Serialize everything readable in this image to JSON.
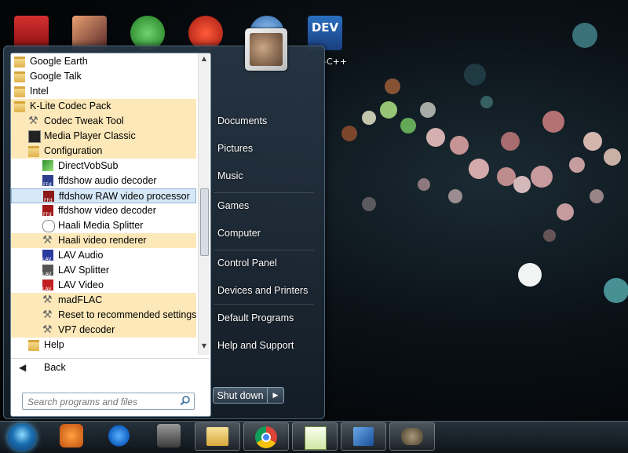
{
  "desktop": {
    "icons": [
      {
        "name": "adobe-reader",
        "label": ""
      },
      {
        "name": "anime-app",
        "label": ""
      },
      {
        "name": "green-app",
        "label": ""
      },
      {
        "name": "ccleaner",
        "label": ""
      },
      {
        "name": "blue-app",
        "label": ""
      },
      {
        "name": "dev-cpp",
        "label": "-C++",
        "icon_text": "DEV"
      }
    ]
  },
  "start_menu": {
    "programs": [
      {
        "label": "Google Earth",
        "icon": "folder-icon",
        "indent": 0,
        "highlight": false
      },
      {
        "label": "Google Talk",
        "icon": "folder-icon",
        "indent": 0,
        "highlight": false
      },
      {
        "label": "Intel",
        "icon": "folder-icon",
        "indent": 0,
        "highlight": false
      },
      {
        "label": "K-Lite Codec Pack",
        "icon": "folder-icon",
        "indent": 0,
        "highlight": true
      },
      {
        "label": "Codec Tweak Tool",
        "icon": "tool-icon",
        "indent": 1,
        "highlight": true
      },
      {
        "label": "Media Player Classic",
        "icon": "mpc-icon",
        "indent": 1,
        "highlight": true
      },
      {
        "label": "Configuration",
        "icon": "folder-icon",
        "indent": 1,
        "highlight": true
      },
      {
        "label": "DirectVobSub",
        "icon": "directvobsub-icon",
        "indent": 2,
        "highlight": false
      },
      {
        "label": "ffdshow audio decoder",
        "icon": "ffdshow-audio-icon",
        "indent": 2,
        "highlight": false
      },
      {
        "label": "ffdshow RAW video processor",
        "icon": "ffdshow-raw-icon",
        "indent": 2,
        "highlight": false,
        "selected": true
      },
      {
        "label": "ffdshow video decoder",
        "icon": "ffdshow-video-icon",
        "indent": 2,
        "highlight": false
      },
      {
        "label": "Haali Media Splitter",
        "icon": "haali-icon",
        "indent": 2,
        "highlight": false
      },
      {
        "label": "Haali video renderer",
        "icon": "tool-icon",
        "indent": 2,
        "highlight": true
      },
      {
        "label": "LAV Audio",
        "icon": "lav-audio-icon",
        "indent": 2,
        "highlight": false
      },
      {
        "label": "LAV Splitter",
        "icon": "lav-splitter-icon",
        "indent": 2,
        "highlight": false
      },
      {
        "label": "LAV Video",
        "icon": "lav-video-icon",
        "indent": 2,
        "highlight": false
      },
      {
        "label": "madFLAC",
        "icon": "tool-icon",
        "indent": 2,
        "highlight": true
      },
      {
        "label": "Reset to recommended settings",
        "icon": "tool-icon",
        "indent": 2,
        "highlight": true
      },
      {
        "label": "VP7 decoder",
        "icon": "tool-icon",
        "indent": 2,
        "highlight": true
      },
      {
        "label": "Help",
        "icon": "folder-icon",
        "indent": 1,
        "highlight": false
      }
    ],
    "back_label": "Back",
    "search_placeholder": "Search programs and files",
    "right_items": [
      {
        "label": "Documents",
        "name": "right-item-documents"
      },
      {
        "label": "Pictures",
        "name": "right-item-pictures"
      },
      {
        "label": "Music",
        "name": "right-item-music"
      },
      {
        "label": "Games",
        "name": "right-item-games"
      },
      {
        "label": "Computer",
        "name": "right-item-computer"
      },
      {
        "label": "Control Panel",
        "name": "right-item-control-panel"
      },
      {
        "label": "Devices and Printers",
        "name": "right-item-devices-and-printers"
      },
      {
        "label": "Default Programs",
        "name": "right-item-default-programs"
      },
      {
        "label": "Help and Support",
        "name": "right-item-help-and-support"
      }
    ],
    "shutdown_label": "Shut down"
  },
  "taskbar": {
    "pinned": [
      {
        "name": "media-player-icon"
      },
      {
        "name": "internet-explorer-icon"
      },
      {
        "name": "game-app-icon"
      },
      {
        "name": "file-explorer-icon"
      },
      {
        "name": "chrome-icon"
      },
      {
        "name": "notepad-plus-plus-icon"
      },
      {
        "name": "network-app-icon"
      },
      {
        "name": "gimp-icon"
      }
    ]
  },
  "colors": {
    "highlight": "#fce8b8",
    "selection": "#d6e8f7"
  }
}
